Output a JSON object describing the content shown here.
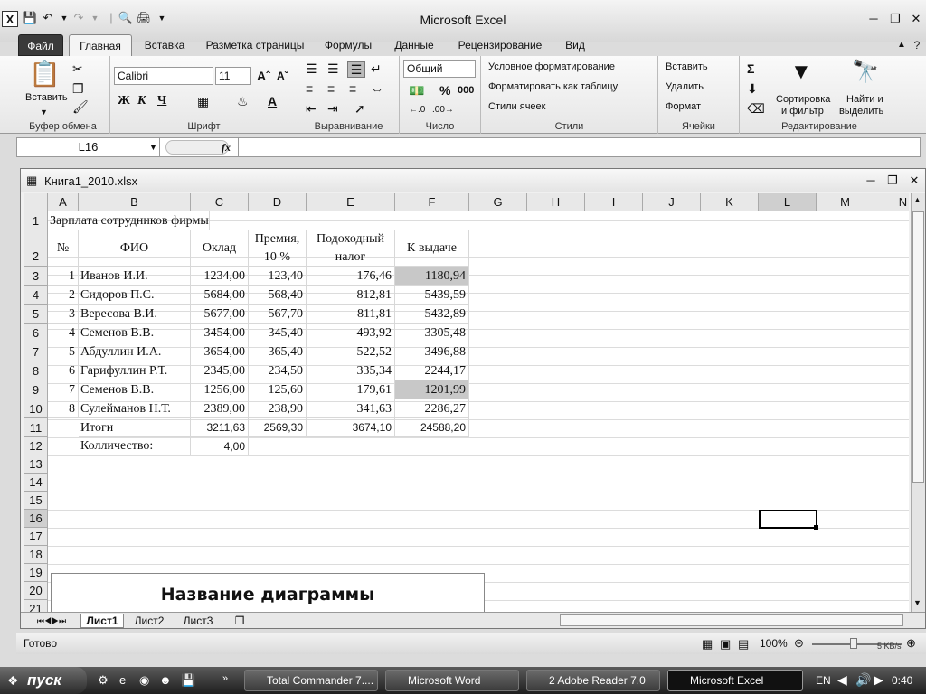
{
  "app": {
    "title": "Microsoft Excel"
  },
  "ribbon_tabs": [
    "Файл",
    "Главная",
    "Вставка",
    "Разметка страницы",
    "Формулы",
    "Данные",
    "Рецензирование",
    "Вид"
  ],
  "ribbon": {
    "clipboard": {
      "paste": "Вставить",
      "label": "Буфер обмена"
    },
    "font": {
      "name": "Calibri",
      "size": "11",
      "label": "Шрифт",
      "bold": "Ж",
      "italic": "К",
      "underline": "Ч"
    },
    "alignment": {
      "label": "Выравнивание"
    },
    "number": {
      "format": "Общий",
      "label": "Число",
      "percent": "%",
      "thousands": "000"
    },
    "styles": {
      "cond": "Условное форматирование",
      "table": "Форматировать как таблицу",
      "cell": "Стили ячеек",
      "label": "Стили"
    },
    "cells": {
      "insert": "Вставить",
      "delete": "Удалить",
      "format": "Формат",
      "label": "Ячейки"
    },
    "editing": {
      "sort1": "Сортировка",
      "sort2": "и фильтр",
      "find1": "Найти и",
      "find2": "выделить",
      "label": "Редактирование",
      "sigma": "Σ"
    }
  },
  "formula_bar": {
    "name_box": "L16",
    "fx": "fx",
    "value": ""
  },
  "workbook": {
    "title": "Книга1_2010.xlsx"
  },
  "columns": [
    "A",
    "B",
    "C",
    "D",
    "E",
    "F",
    "G",
    "H",
    "I",
    "J",
    "K",
    "L",
    "M",
    "N"
  ],
  "rows": [
    "1",
    "2",
    "3",
    "4",
    "5",
    "6",
    "7",
    "8",
    "9",
    "10",
    "11",
    "12",
    "13",
    "14",
    "15",
    "16",
    "17",
    "18",
    "19",
    "20",
    "21"
  ],
  "sheet": {
    "title": "Зарплата сотрудников фирмы",
    "headers": {
      "num": "№",
      "fio": "ФИО",
      "salary": "Оклад",
      "bonus1": "Премия,",
      "bonus2": "10 %",
      "tax1": "Подоходный",
      "tax2": "налог",
      "pay": "К выдаче"
    },
    "data": [
      {
        "n": "1",
        "fio": "Иванов И.И.",
        "salary": "1234,00",
        "bonus": "123,40",
        "tax": "176,46",
        "pay": "1180,94"
      },
      {
        "n": "2",
        "fio": "Сидоров П.С.",
        "salary": "5684,00",
        "bonus": "568,40",
        "tax": "812,81",
        "pay": "5439,59"
      },
      {
        "n": "3",
        "fio": "Вересова В.И.",
        "salary": "5677,00",
        "bonus": "567,70",
        "tax": "811,81",
        "pay": "5432,89"
      },
      {
        "n": "4",
        "fio": "Семенов В.В.",
        "salary": "3454,00",
        "bonus": "345,40",
        "tax": "493,92",
        "pay": "3305,48"
      },
      {
        "n": "5",
        "fio": "Абдуллин И.А.",
        "salary": "3654,00",
        "bonus": "365,40",
        "tax": "522,52",
        "pay": "3496,88"
      },
      {
        "n": "6",
        "fio": "Гарифуллин Р.Т.",
        "salary": "2345,00",
        "bonus": "234,50",
        "tax": "335,34",
        "pay": "2244,17"
      },
      {
        "n": "7",
        "fio": "Семенов В.В.",
        "salary": "1256,00",
        "bonus": "125,60",
        "tax": "179,61",
        "pay": "1201,99"
      },
      {
        "n": "8",
        "fio": "Сулейманов Н.Т.",
        "salary": "2389,00",
        "bonus": "238,90",
        "tax": "341,63",
        "pay": "2286,27"
      }
    ],
    "totals": {
      "label": "Итоги",
      "salary": "3211,63",
      "bonus": "2569,30",
      "tax": "3674,10",
      "pay": "24588,20"
    },
    "count": {
      "label": "Колличество:",
      "value": "4,00"
    },
    "chart_title": "Название диаграммы"
  },
  "sheet_tabs": [
    "Лист1",
    "Лист2",
    "Лист3"
  ],
  "status": {
    "ready": "Готово",
    "zoom": "100%",
    "net": "5 KB/s"
  },
  "taskbar": {
    "start": "пуск",
    "tasks": [
      "Total Commander 7....",
      "Microsoft Word",
      "2 Adobe Reader 7.0",
      "Microsoft Excel"
    ],
    "lang": "EN",
    "clock": "0:40"
  },
  "colors": {
    "highlight": "#c8c8c8",
    "selected_cell_border": "#000000"
  }
}
